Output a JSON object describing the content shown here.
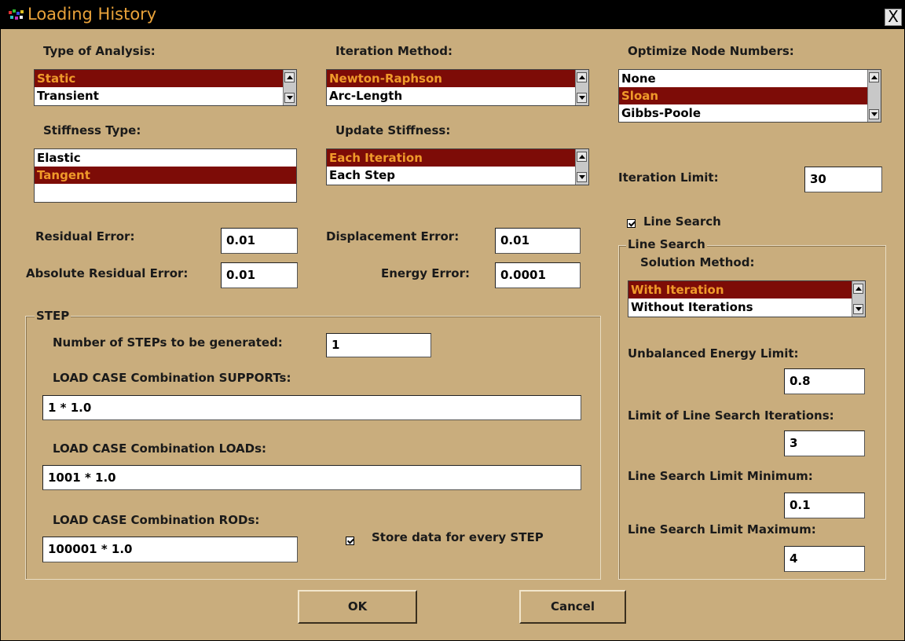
{
  "window": {
    "title": "Loading History",
    "close_label": "X"
  },
  "analysis": {
    "label": "Type of Analysis:",
    "options": [
      "Static",
      "Transient"
    ],
    "selected": 0
  },
  "iteration_method": {
    "label": "Iteration Method:",
    "options": [
      "Newton-Raphson",
      "Arc-Length"
    ],
    "selected": 0
  },
  "optimize_nodes": {
    "label": "Optimize Node Numbers:",
    "options": [
      "None",
      "Sloan",
      "Gibbs-Poole"
    ],
    "selected": 1
  },
  "stiffness_type": {
    "label": "Stiffness Type:",
    "options": [
      "Elastic",
      "Tangent"
    ],
    "selected": 1
  },
  "update_stiffness": {
    "label": "Update Stiffness:",
    "options": [
      "Each Iteration",
      "Each Step"
    ],
    "selected": 0
  },
  "iteration_limit": {
    "label": "Iteration Limit:",
    "value": "30"
  },
  "line_search_toggle": {
    "label": "Line Search",
    "checked": true
  },
  "errors": {
    "residual": {
      "label": "Residual Error:",
      "value": "0.01"
    },
    "abs_residual": {
      "label": "Absolute Residual Error:",
      "value": "0.01"
    },
    "displacement": {
      "label": "Displacement Error:",
      "value": "0.01"
    },
    "energy": {
      "label": "Energy Error:",
      "value": "0.0001"
    }
  },
  "step": {
    "legend": "STEP",
    "num_steps": {
      "label": "Number of STEPs to be generated:",
      "value": "1"
    },
    "supports": {
      "label": "LOAD CASE Combination SUPPORTs:",
      "value": "1 * 1.0"
    },
    "loads": {
      "label": "LOAD CASE Combination LOADs:",
      "value": "1001 * 1.0"
    },
    "rods": {
      "label": "LOAD CASE Combination RODs:",
      "value": "100001 * 1.0"
    },
    "store": {
      "label": "Store data for every STEP",
      "checked": true
    }
  },
  "line_search": {
    "legend": "Line Search",
    "solution_label": "Solution Method:",
    "options": [
      "With Iteration",
      "Without Iterations"
    ],
    "selected": 0,
    "unbalanced": {
      "label": "Unbalanced Energy Limit:",
      "value": "0.8"
    },
    "limit_iters": {
      "label": "Limit of Line Search Iterations:",
      "value": "3"
    },
    "limit_min": {
      "label": "Line Search Limit Minimum:",
      "value": "0.1"
    },
    "limit_max": {
      "label": "Line Search Limit Maximum:",
      "value": "4"
    }
  },
  "buttons": {
    "ok": "OK",
    "cancel": "Cancel"
  },
  "colors": {
    "background": "#c9ad7d",
    "selection": "#7d0c07",
    "selection_text": "#f09a2a",
    "title_text": "#e9a23a"
  }
}
